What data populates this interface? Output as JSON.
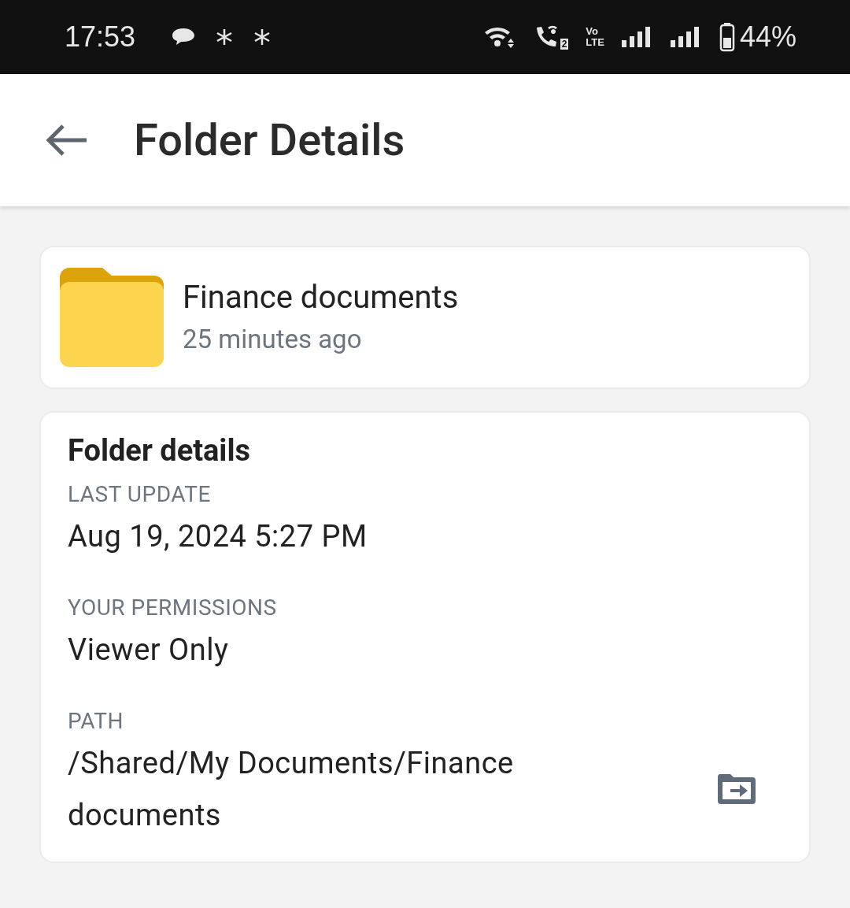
{
  "status_bar": {
    "time": "17:53",
    "volte": [
      "Vo",
      "LTE"
    ],
    "sim_badge": "2",
    "battery": "44%"
  },
  "app_bar": {
    "title": "Folder Details"
  },
  "folder": {
    "name": "Finance documents",
    "modified": "25 minutes ago"
  },
  "details": {
    "heading": "Folder details",
    "fields": [
      {
        "label": "LAST UPDATE",
        "value": "Aug 19, 2024 5:27 PM"
      },
      {
        "label": "YOUR PERMISSIONS",
        "value": "Viewer Only"
      },
      {
        "label": "PATH",
        "value": "/Shared/My Documents/Finance documents",
        "action": true
      }
    ]
  }
}
